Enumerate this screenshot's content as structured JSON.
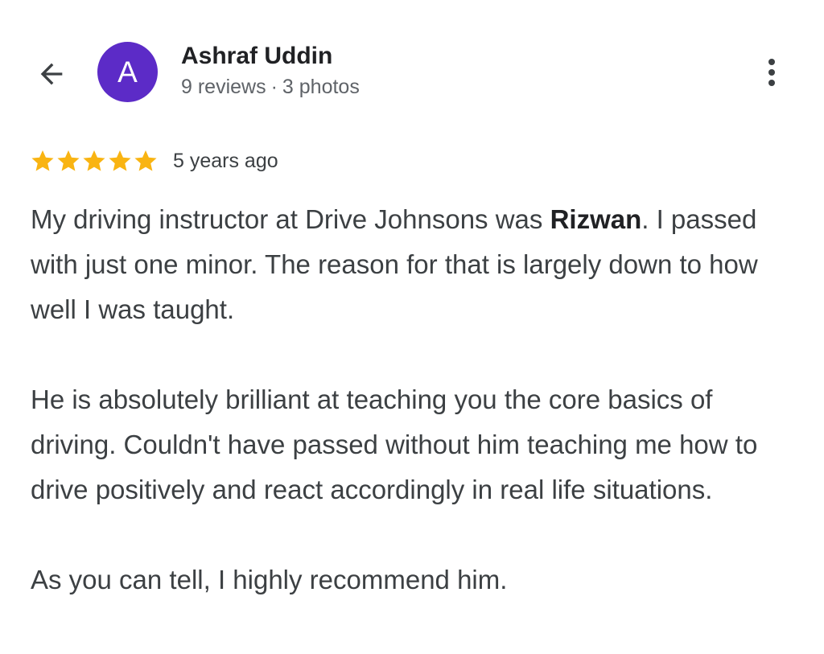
{
  "header": {
    "back_icon": "arrow-back-icon",
    "avatar_letter": "A",
    "avatar_color": "#5c2bc7",
    "author_name": "Ashraf Uddin",
    "reviews_count": "9 reviews",
    "separator": "·",
    "photos_count": "3 photos",
    "more_icon": "more-vert-icon"
  },
  "review": {
    "rating": 5,
    "max_rating": 5,
    "star_color": "#f9b412",
    "time": "5 years ago",
    "paragraph1_start": "My driving instructor at Drive Johnsons was ",
    "paragraph1_bold": "Rizwan",
    "paragraph1_end": ". I passed with just one minor. The reason for that is largely down to how well I was taught.",
    "paragraph2": "He is absolutely brilliant at teaching you the core basics of driving. Couldn't have passed without him teaching me how to drive positively and react accordingly in real life situations.",
    "paragraph3": "As you can tell, I highly recommend him."
  }
}
